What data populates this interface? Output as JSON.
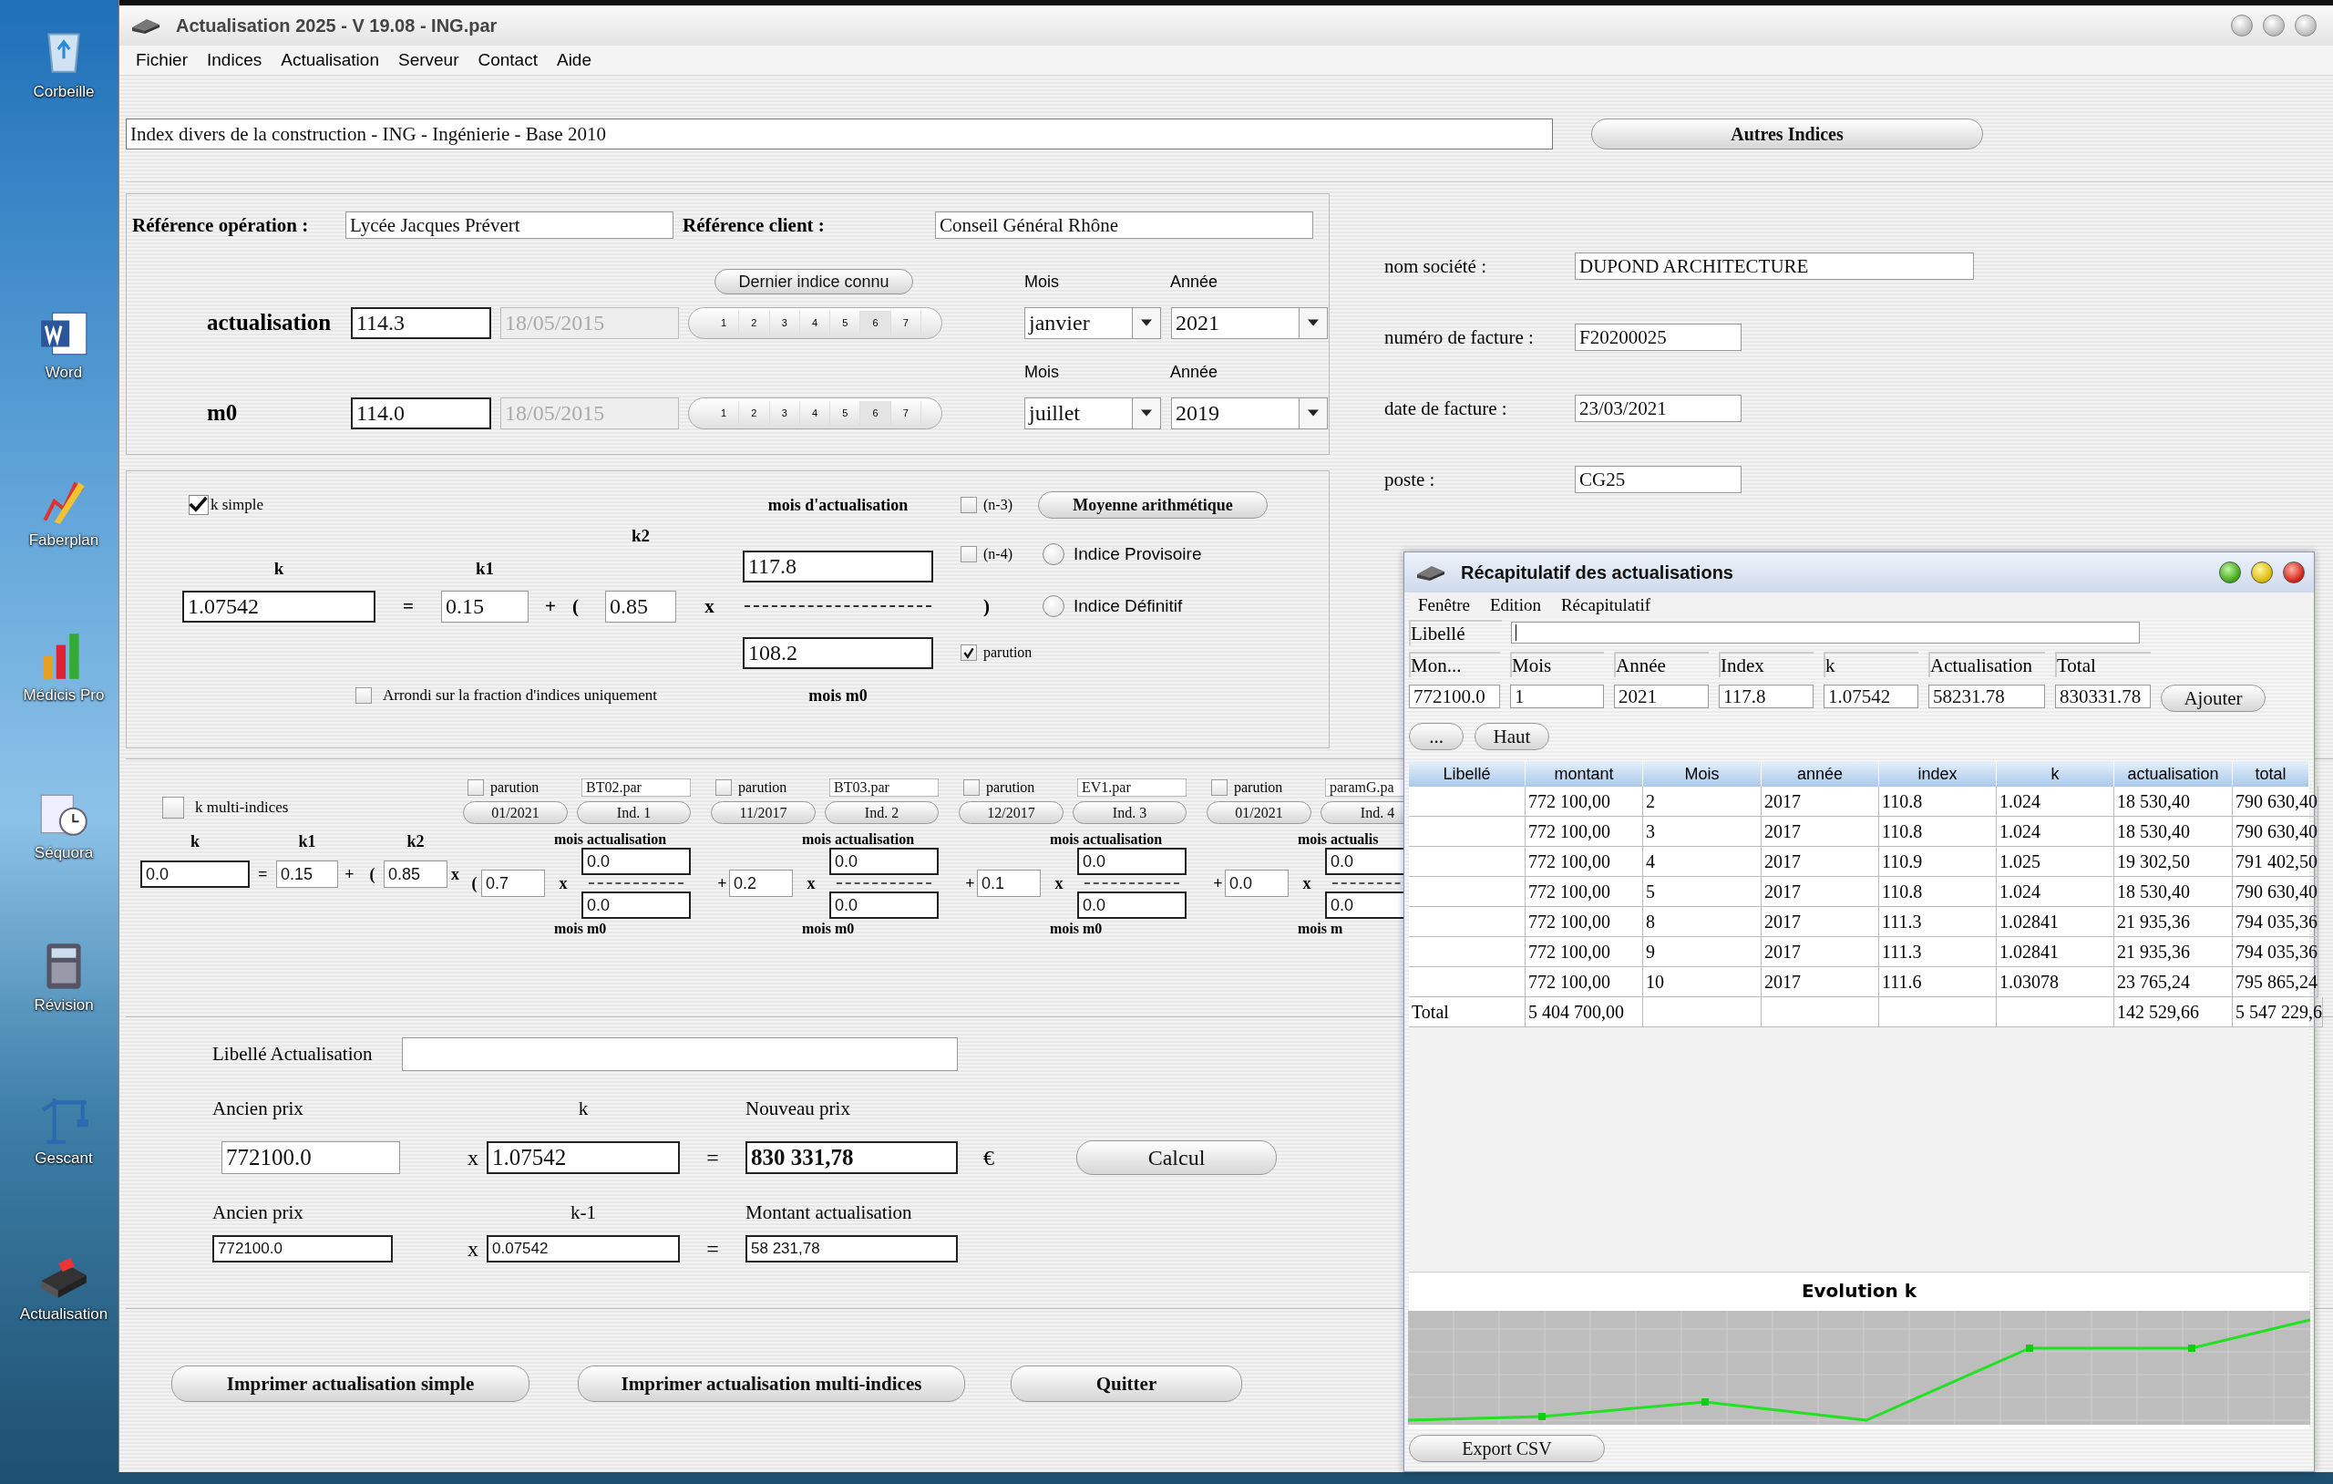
{
  "desktop_icons": [
    {
      "label": "Corbeille",
      "kind": "bin"
    },
    {
      "label": "Word",
      "kind": "word"
    },
    {
      "label": "Faberplan",
      "kind": "pencil"
    },
    {
      "label": "Médicis Pro",
      "kind": "bars"
    },
    {
      "label": "Séquora",
      "kind": "clock"
    },
    {
      "label": "Révision",
      "kind": "calculator"
    },
    {
      "label": "Gescant",
      "kind": "crane"
    },
    {
      "label": "Actualisation",
      "kind": "terminal"
    }
  ],
  "window": {
    "title": "Actualisation 2025 - V 19.08 - ING.par"
  },
  "menu": [
    "Fichier",
    "Indices",
    "Actualisation",
    "Serveur",
    "Contact",
    "Aide"
  ],
  "index_title": "Index divers de la construction - ING - Ingénierie - Base 2010",
  "other_indices_button": "Autres Indices",
  "references": {
    "operation_label": "Référence opération :",
    "operation_value": "Lycée Jacques Prévert",
    "client_label": "Référence client :",
    "client_value": "Conseil Général Rhône"
  },
  "last_index_button": "Dernier indice connu",
  "index_rows": [
    {
      "label": "actualisation",
      "value": "114.3",
      "date": "18/05/2015",
      "steps": [
        "1",
        "2",
        "3",
        "4",
        "5",
        "6",
        "7"
      ],
      "month_label": "Mois",
      "month": "janvier",
      "year_label": "Année",
      "year": "2021"
    },
    {
      "label": "m0",
      "value": "114.0",
      "date": "18/05/2015",
      "steps": [
        "1",
        "2",
        "3",
        "4",
        "5",
        "6",
        "7"
      ],
      "month_label": "Mois",
      "month": "juillet",
      "year_label": "Année",
      "year": "2019"
    }
  ],
  "k_simple": {
    "checked": true,
    "label": "k simple",
    "k_label": "k",
    "k1_label": "k1",
    "k2_label": "k2",
    "k": "1.07542",
    "equals": "=",
    "k1": "0.15",
    "plus": "+",
    "open": "(",
    "k2": "0.85",
    "times": "x",
    "close": ")",
    "numerator_label": "mois d'actualisation",
    "numerator": "117.8",
    "denominator": "108.2",
    "denominator_label": "mois m0",
    "options": [
      {
        "label": "(n-3)",
        "checked": false
      },
      {
        "label": "(n-4)",
        "checked": false
      },
      {
        "label": "parution",
        "checked": true
      }
    ],
    "average_button": "Moyenne arithmétique",
    "radios": [
      {
        "label": "Indice Provisoire",
        "selected": false
      },
      {
        "label": "Indice Définitif",
        "selected": false
      }
    ],
    "rounding": {
      "label": "Arrondi sur la fraction d'indices uniquement",
      "checked": false
    }
  },
  "company": [
    {
      "label": "nom société :",
      "value": "DUPOND ARCHITECTURE"
    },
    {
      "label": "numéro de facture :",
      "value": "F20200025"
    },
    {
      "label": "date de facture :",
      "value": "23/03/2021"
    },
    {
      "label": "poste :",
      "value": "CG25"
    }
  ],
  "k_multi": {
    "checked": false,
    "label": "k multi-indices",
    "k_label": "k",
    "k1_label": "k1",
    "k2_label": "k2",
    "k": "0.0",
    "equals": "=",
    "k1": "0.15",
    "plus": "+",
    "open": "(",
    "k2": "0.85",
    "times": "x",
    "indices": [
      {
        "parution_label": "parution",
        "parution_checked": false,
        "file": "BT02.par",
        "date": "01/2021",
        "button": "Ind. 1",
        "lead": "(",
        "weight": "0.7",
        "times": "x",
        "numerator_label": "mois actualisation",
        "numerator": "0.0",
        "denominator": "0.0",
        "denominator_label": "mois m0"
      },
      {
        "parution_label": "parution",
        "parution_checked": false,
        "file": "BT03.par",
        "date": "11/2017",
        "button": "Ind. 2",
        "lead": "+",
        "weight": "0.2",
        "times": "x",
        "numerator_label": "mois actualisation",
        "numerator": "0.0",
        "denominator": "0.0",
        "denominator_label": "mois m0"
      },
      {
        "parution_label": "parution",
        "parution_checked": false,
        "file": "EV1.par",
        "date": "12/2017",
        "button": "Ind. 3",
        "lead": "+",
        "weight": "0.1",
        "times": "x",
        "numerator_label": "mois actualisation",
        "numerator": "0.0",
        "denominator": "0.0",
        "denominator_label": "mois m0"
      },
      {
        "parution_label": "parution",
        "parution_checked": false,
        "file": "paramG.pa",
        "date": "01/2021",
        "button": "Ind. 4",
        "lead": "+",
        "weight": "0.0",
        "times": "x",
        "numerator_label": "mois actualis",
        "numerator": "0.0",
        "denominator": "0.0",
        "denominator_label": "mois m"
      }
    ]
  },
  "result": {
    "label_libelle": "Libellé Actualisation",
    "old_price_label": "Ancien prix",
    "k_label": "k",
    "new_price_label": "Nouveau prix",
    "old_price": "772100.0",
    "times": "x",
    "k": "1.07542",
    "equals": "=",
    "new_price": "830 331,78",
    "currency": "€",
    "calc_button": "Calcul",
    "old_price_label_2": "Ancien prix",
    "k_minus_label": "k-1",
    "amount_label": "Montant actualisation",
    "old_price_2": "772100.0",
    "times_2": "x",
    "k_minus": "0.07542",
    "equals_2": "=",
    "amount": "58 231,78"
  },
  "buttons": [
    "Imprimer actualisation simple",
    "Imprimer actualisation multi-indices",
    "Quitter"
  ],
  "recap": {
    "title": "Récapitulatif des actualisations",
    "menu": [
      "Fenêtre",
      "Edition",
      "Récapitulatif"
    ],
    "libelle_label": "Libellé",
    "entry_labels": [
      "Mon...",
      "Mois",
      "Année",
      "Index",
      "k",
      "Actualisation",
      "Total"
    ],
    "entry_values": [
      "772100.0",
      "1",
      "2021",
      "117.8",
      "1.07542",
      "58231.78",
      "830331.78"
    ],
    "add_button": "Ajouter",
    "more_button": "...",
    "top_button": "Haut",
    "table": {
      "columns": [
        "Libellé",
        "montant",
        "Mois",
        "année",
        "index",
        "k",
        "actualisation",
        "total"
      ],
      "rows": [
        {
          "montant": "772 100,00",
          "mois": "2",
          "annee": "2017",
          "index": "110.8",
          "k": "1.024",
          "actualisation": "18 530,40",
          "total": "790 630,40"
        },
        {
          "montant": "772 100,00",
          "mois": "3",
          "annee": "2017",
          "index": "110.8",
          "k": "1.024",
          "actualisation": "18 530,40",
          "total": "790 630,40"
        },
        {
          "montant": "772 100,00",
          "mois": "4",
          "annee": "2017",
          "index": "110.9",
          "k": "1.025",
          "actualisation": "19 302,50",
          "total": "791 402,50"
        },
        {
          "montant": "772 100,00",
          "mois": "5",
          "annee": "2017",
          "index": "110.8",
          "k": "1.024",
          "actualisation": "18 530,40",
          "total": "790 630,40"
        },
        {
          "montant": "772 100,00",
          "mois": "8",
          "annee": "2017",
          "index": "111.3",
          "k": "1.02841",
          "actualisation": "21 935,36",
          "total": "794 035,36"
        },
        {
          "montant": "772 100,00",
          "mois": "9",
          "annee": "2017",
          "index": "111.3",
          "k": "1.02841",
          "actualisation": "21 935,36",
          "total": "794 035,36"
        },
        {
          "montant": "772 100,00",
          "mois": "10",
          "annee": "2017",
          "index": "111.6",
          "k": "1.03078",
          "actualisation": "23 765,24",
          "total": "795 865,24"
        }
      ],
      "total": {
        "label": "Total",
        "montant": "5 404 700,00",
        "actualisation": "142 529,66",
        "total": "5 547 229,6"
      }
    },
    "chart_title": "Evolution k",
    "export_button": "Export CSV"
  }
}
